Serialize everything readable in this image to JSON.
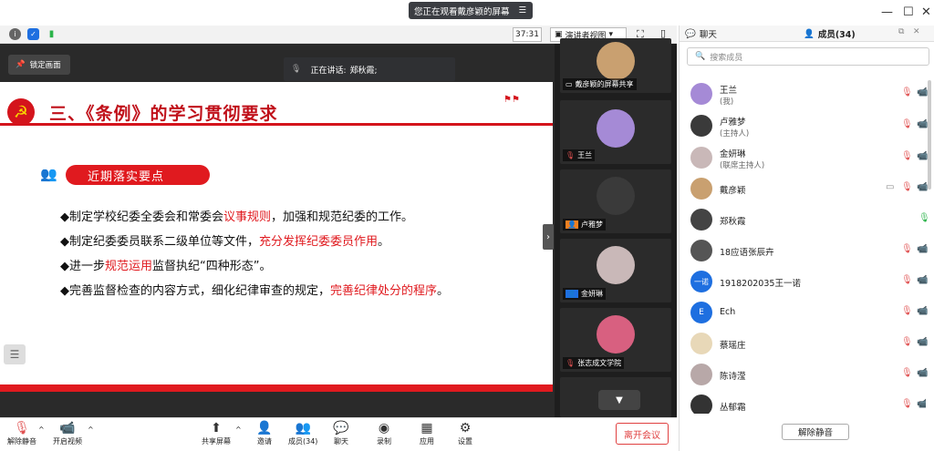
{
  "banner": {
    "text": "您正在观看戴彦颖的屏幕",
    "menu_icon": "menu-icon"
  },
  "window": {
    "minimize": "—",
    "maximize": "☐",
    "close": "✕"
  },
  "toolbar": {
    "timer": "37:31",
    "presenter_label": "演讲者视图",
    "presenter_arrow": "▾"
  },
  "stage": {
    "lock_label": "锁定画面",
    "speaker_prefix": "正在讲话:",
    "speaker_name": "郑秋霞;",
    "slide": {
      "title": "三、《条例》的学习贯彻要求",
      "section": "近期落实要点",
      "bullets": [
        {
          "plain1": "◆制定学校纪委全委会和常委会",
          "hl": "议事规则",
          "plain2": "，加强和规范纪委的工作。"
        },
        {
          "plain1": "◆制定纪委委员联系二级单位等文件，",
          "hl": "充分发挥纪委委员作用",
          "plain2": "。"
        },
        {
          "plain1": "◆进一步",
          "hl": "规范运用",
          "plain2": "监督执纪“四种形态”。"
        },
        {
          "plain1": "◆完善监督检查的内容方式，细化纪律审查的规定，",
          "hl": "完善纪律处分的程序",
          "plain2": "。"
        }
      ]
    }
  },
  "video_tiles": [
    {
      "name": "戴彦颖的屏幕共享",
      "color": "#c9a070"
    },
    {
      "name": "王兰",
      "color": "#a58ad6"
    },
    {
      "name": "卢雅梦",
      "color": "#3a3a3a"
    },
    {
      "name": "金妍琳",
      "color": "#c9b8b8"
    },
    {
      "name": "张志成文学院",
      "color": "#d86080"
    }
  ],
  "bottombar": {
    "unmute": "解除静音",
    "video": "开启视频",
    "share": "共享屏幕",
    "invite": "邀请",
    "members": "成员(34)",
    "chat": "聊天",
    "record": "录制",
    "apps": "应用",
    "settings": "设置",
    "leave": "离开会议"
  },
  "right_panel": {
    "chat_tab": "聊天",
    "members_tab": "成员(34)",
    "search_placeholder": "搜索成员",
    "unmute_all": "解除静音",
    "members": [
      {
        "name": "王兰",
        "role": "(我)",
        "avatar": "#a58ad6",
        "initial": ""
      },
      {
        "name": "卢雅梦",
        "role": "(主持人)",
        "avatar": "#3a3a3a",
        "initial": ""
      },
      {
        "name": "金妍琳",
        "role": "(联席主持人)",
        "avatar": "#c9b8b8",
        "initial": ""
      },
      {
        "name": "戴彦颖",
        "role": "",
        "avatar": "#c9a070",
        "initial": ""
      },
      {
        "name": "郑秋霞",
        "role": "",
        "avatar": "#444444",
        "initial": ""
      },
      {
        "name": "18应语张辰卉",
        "role": "",
        "avatar": "#555555",
        "initial": ""
      },
      {
        "name": "1918202035王一诺",
        "role": "",
        "avatar": "#1e6fe0",
        "initial": "一诺"
      },
      {
        "name": "Ech",
        "role": "",
        "avatar": "#1e6fe0",
        "initial": "E"
      },
      {
        "name": "蔡瑶庄",
        "role": "",
        "avatar": "#e8d8b8",
        "initial": ""
      },
      {
        "name": "陈诗滢",
        "role": "",
        "avatar": "#b8a8a8",
        "initial": ""
      },
      {
        "name": "丛郁霜",
        "role": "",
        "avatar": "#333333",
        "initial": ""
      }
    ]
  }
}
